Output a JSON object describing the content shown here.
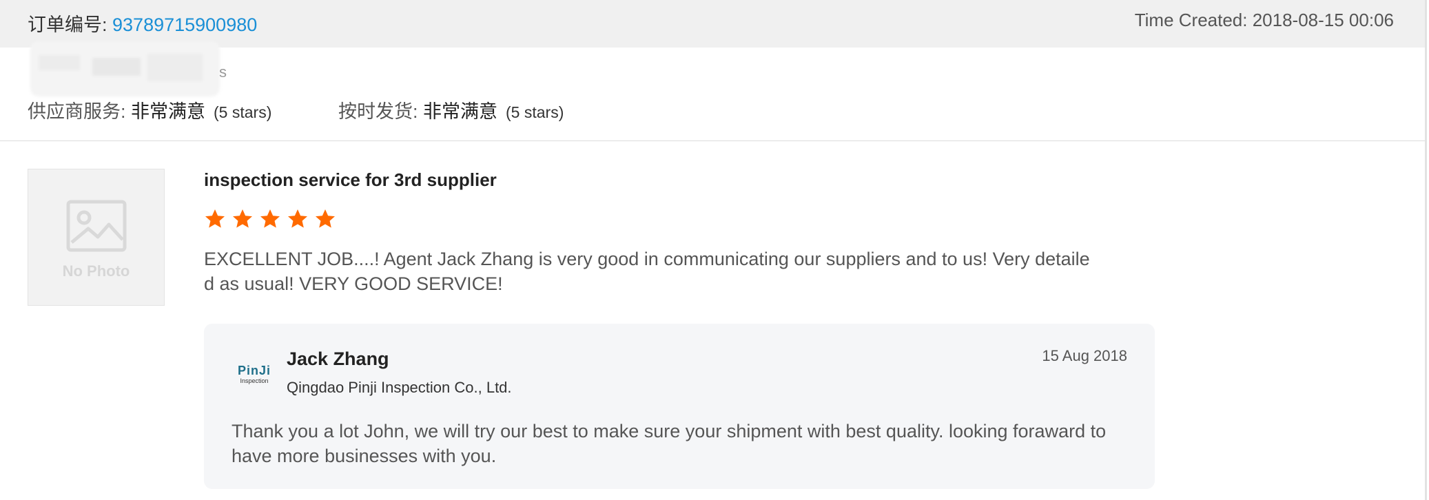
{
  "header": {
    "order_label": "订单编号: ",
    "order_number": "93789715900980",
    "time_created": "Time Created: 2018-08-15 00:06"
  },
  "blurred": {
    "tail_char": "s"
  },
  "ratings": [
    {
      "label": "供应商服务: ",
      "value": "非常满意",
      "stars": "(5 stars)"
    },
    {
      "label": "按时发货: ",
      "value": "非常满意",
      "stars": "(5 stars)"
    }
  ],
  "product": {
    "placeholder_text": "No Photo"
  },
  "review": {
    "title": "inspection service for 3rd supplier",
    "star_count": 5,
    "star_color": "#ff6a00",
    "text": "EXCELLENT JOB....! Agent Jack Zhang is very good in communicating our suppliers and to us! Very detailed as usual! VERY GOOD SERVICE!"
  },
  "reply": {
    "logo_main": "PinJi",
    "logo_sub": "Inspection",
    "name": "Jack Zhang",
    "company": "Qingdao Pinji Inspection Co., Ltd.",
    "date": "15 Aug 2018",
    "text": "Thank you a lot John, we will try our best to make sure your shipment with best quality. looking foraward to have more businesses with you."
  },
  "colors": {
    "link_blue": "#1a8fd6",
    "header_bg": "#f0f0f0",
    "reply_bg": "#f5f6f8"
  }
}
